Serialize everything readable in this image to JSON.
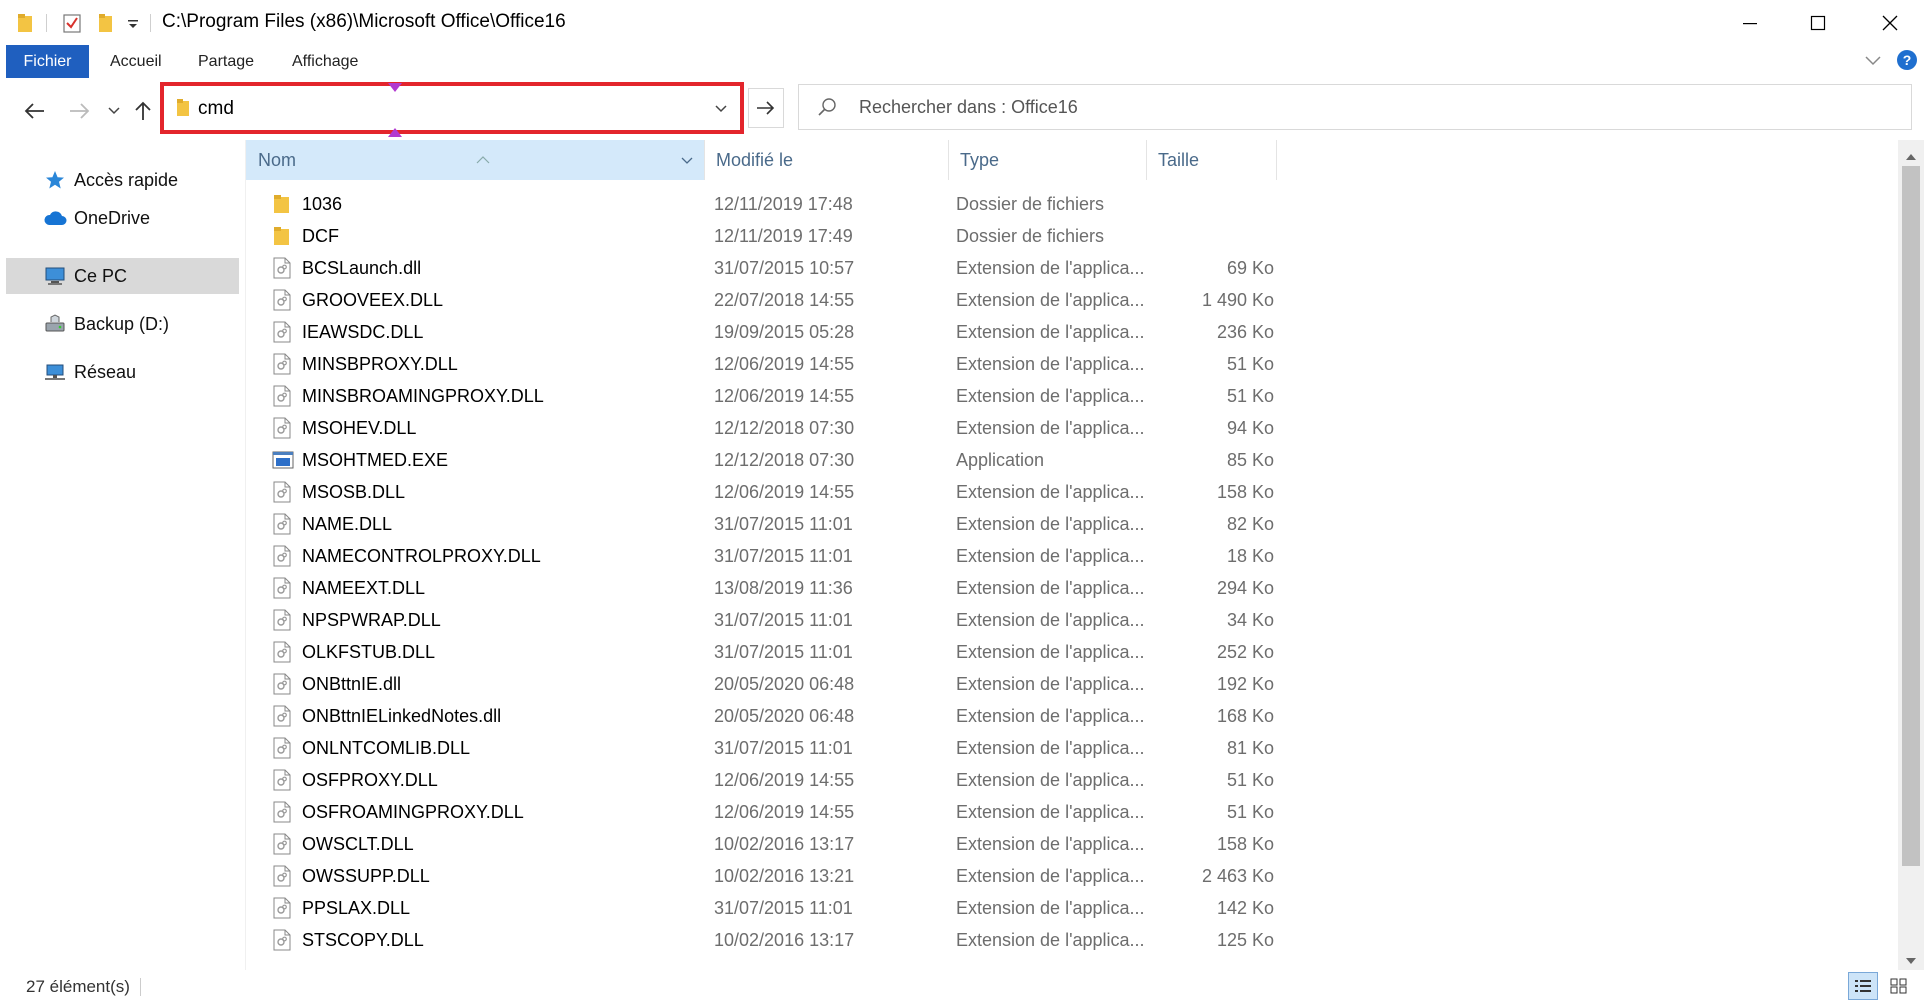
{
  "window": {
    "title": "C:\\Program Files (x86)\\Microsoft Office\\Office16"
  },
  "ribbon": {
    "tabs": [
      {
        "label": "Fichier",
        "active": true
      },
      {
        "label": "Accueil"
      },
      {
        "label": "Partage"
      },
      {
        "label": "Affichage"
      }
    ]
  },
  "address": {
    "value": "cmd"
  },
  "search": {
    "placeholder": "Rechercher dans : Office16"
  },
  "sidebar": {
    "items": [
      {
        "label": "Accès rapide",
        "icon": "star-icon"
      },
      {
        "label": "OneDrive",
        "icon": "cloud-icon"
      },
      {
        "label": "Ce PC",
        "icon": "computer-icon",
        "selected": true
      },
      {
        "label": "Backup (D:)",
        "icon": "drive-icon"
      },
      {
        "label": "Réseau",
        "icon": "network-icon"
      }
    ]
  },
  "columns": {
    "name": "Nom",
    "modified": "Modifié le",
    "type": "Type",
    "size": "Taille"
  },
  "files": [
    {
      "name": "1036",
      "date": "12/11/2019 17:48",
      "type": "Dossier de fichiers",
      "size": "",
      "kind": "folder"
    },
    {
      "name": "DCF",
      "date": "12/11/2019 17:49",
      "type": "Dossier de fichiers",
      "size": "",
      "kind": "folder"
    },
    {
      "name": "BCSLaunch.dll",
      "date": "31/07/2015 10:57",
      "type": "Extension de l'applica...",
      "size": "69 Ko",
      "kind": "dll"
    },
    {
      "name": "GROOVEEX.DLL",
      "date": "22/07/2018 14:55",
      "type": "Extension de l'applica...",
      "size": "1 490 Ko",
      "kind": "dll"
    },
    {
      "name": "IEAWSDC.DLL",
      "date": "19/09/2015 05:28",
      "type": "Extension de l'applica...",
      "size": "236 Ko",
      "kind": "dll"
    },
    {
      "name": "MINSBPROXY.DLL",
      "date": "12/06/2019 14:55",
      "type": "Extension de l'applica...",
      "size": "51 Ko",
      "kind": "dll"
    },
    {
      "name": "MINSBROAMINGPROXY.DLL",
      "date": "12/06/2019 14:55",
      "type": "Extension de l'applica...",
      "size": "51 Ko",
      "kind": "dll"
    },
    {
      "name": "MSOHEV.DLL",
      "date": "12/12/2018 07:30",
      "type": "Extension de l'applica...",
      "size": "94 Ko",
      "kind": "dll"
    },
    {
      "name": "MSOHTMED.EXE",
      "date": "12/12/2018 07:30",
      "type": "Application",
      "size": "85 Ko",
      "kind": "exe"
    },
    {
      "name": "MSOSB.DLL",
      "date": "12/06/2019 14:55",
      "type": "Extension de l'applica...",
      "size": "158 Ko",
      "kind": "dll"
    },
    {
      "name": "NAME.DLL",
      "date": "31/07/2015 11:01",
      "type": "Extension de l'applica...",
      "size": "82 Ko",
      "kind": "dll"
    },
    {
      "name": "NAMECONTROLPROXY.DLL",
      "date": "31/07/2015 11:01",
      "type": "Extension de l'applica...",
      "size": "18 Ko",
      "kind": "dll"
    },
    {
      "name": "NAMEEXT.DLL",
      "date": "13/08/2019 11:36",
      "type": "Extension de l'applica...",
      "size": "294 Ko",
      "kind": "dll"
    },
    {
      "name": "NPSPWRAP.DLL",
      "date": "31/07/2015 11:01",
      "type": "Extension de l'applica...",
      "size": "34 Ko",
      "kind": "dll"
    },
    {
      "name": "OLKFSTUB.DLL",
      "date": "31/07/2015 11:01",
      "type": "Extension de l'applica...",
      "size": "252 Ko",
      "kind": "dll"
    },
    {
      "name": "ONBttnIE.dll",
      "date": "20/05/2020 06:48",
      "type": "Extension de l'applica...",
      "size": "192 Ko",
      "kind": "dll"
    },
    {
      "name": "ONBttnIELinkedNotes.dll",
      "date": "20/05/2020 06:48",
      "type": "Extension de l'applica...",
      "size": "168 Ko",
      "kind": "dll"
    },
    {
      "name": "ONLNTCOMLIB.DLL",
      "date": "31/07/2015 11:01",
      "type": "Extension de l'applica...",
      "size": "81 Ko",
      "kind": "dll"
    },
    {
      "name": "OSFPROXY.DLL",
      "date": "12/06/2019 14:55",
      "type": "Extension de l'applica...",
      "size": "51 Ko",
      "kind": "dll"
    },
    {
      "name": "OSFROAMINGPROXY.DLL",
      "date": "12/06/2019 14:55",
      "type": "Extension de l'applica...",
      "size": "51 Ko",
      "kind": "dll"
    },
    {
      "name": "OWSCLT.DLL",
      "date": "10/02/2016 13:17",
      "type": "Extension de l'applica...",
      "size": "158 Ko",
      "kind": "dll"
    },
    {
      "name": "OWSSUPP.DLL",
      "date": "10/02/2016 13:21",
      "type": "Extension de l'applica...",
      "size": "2 463 Ko",
      "kind": "dll"
    },
    {
      "name": "PPSLAX.DLL",
      "date": "31/07/2015 11:01",
      "type": "Extension de l'applica...",
      "size": "142 Ko",
      "kind": "dll"
    },
    {
      "name": "STSCOPY.DLL",
      "date": "10/02/2016 13:17",
      "type": "Extension de l'applica...",
      "size": "125 Ko",
      "kind": "dll"
    }
  ],
  "status": {
    "count": "27 élément(s)"
  },
  "colors": {
    "accent": "#1f5fbf",
    "highlight_border": "#e3252c",
    "selected_column": "#d4e9fa"
  }
}
